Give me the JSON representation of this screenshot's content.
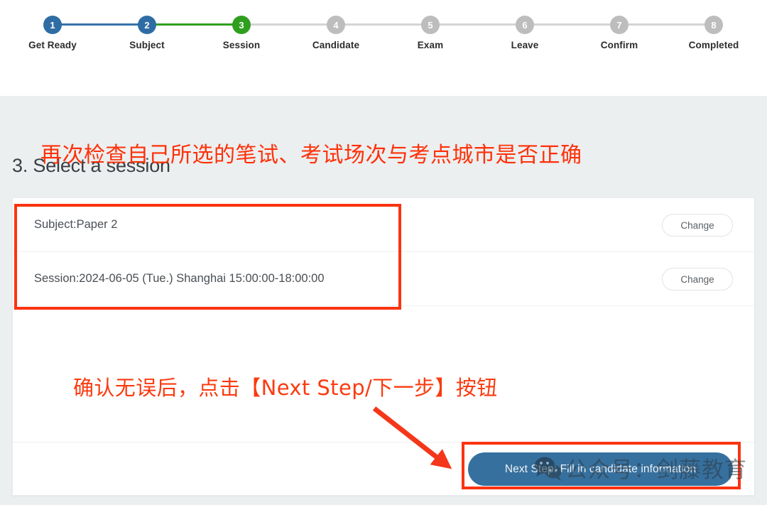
{
  "stepper": {
    "steps": [
      {
        "number": "1",
        "label": "Get Ready",
        "state": "done",
        "color": "#2e6da4"
      },
      {
        "number": "2",
        "label": "Subject",
        "state": "done",
        "color": "#2e6da4"
      },
      {
        "number": "3",
        "label": "Session",
        "state": "current",
        "color": "#2f9e1f"
      },
      {
        "number": "4",
        "label": "Candidate",
        "state": "pending",
        "color": "#bdbdbd"
      },
      {
        "number": "5",
        "label": "Exam",
        "state": "pending",
        "color": "#bdbdbd"
      },
      {
        "number": "6",
        "label": "Leave",
        "state": "pending",
        "color": "#bdbdbd"
      },
      {
        "number": "7",
        "label": "Confirm",
        "state": "pending",
        "color": "#bdbdbd"
      },
      {
        "number": "8",
        "label": "Completed",
        "state": "pending",
        "color": "#bdbdbd"
      }
    ]
  },
  "main": {
    "section_title": "3. Select a session",
    "rows": [
      {
        "text": "Subject:Paper 2",
        "action_label": "Change"
      },
      {
        "text": "Session:2024-06-05 (Tue.) Shanghai 15:00:00-18:00:00",
        "action_label": "Change"
      }
    ],
    "next_button_label": "Next Step: Fill in candidate information"
  },
  "annotations": {
    "color": "#fb3310",
    "top_note": "再次检查自己所选的笔试、考试场次与考点城市是否正确",
    "mid_note": "确认无误后，点击【Next Step/下一步】按钮",
    "box_rows_label": "highlight-selected-subject-and-session",
    "box_button_label": "highlight-next-step-button",
    "arrow_label": "arrow-pointing-to-next-step-button"
  },
  "watermark": {
    "text": "公众号：剑藤教育",
    "icon": "wechat-icon"
  }
}
